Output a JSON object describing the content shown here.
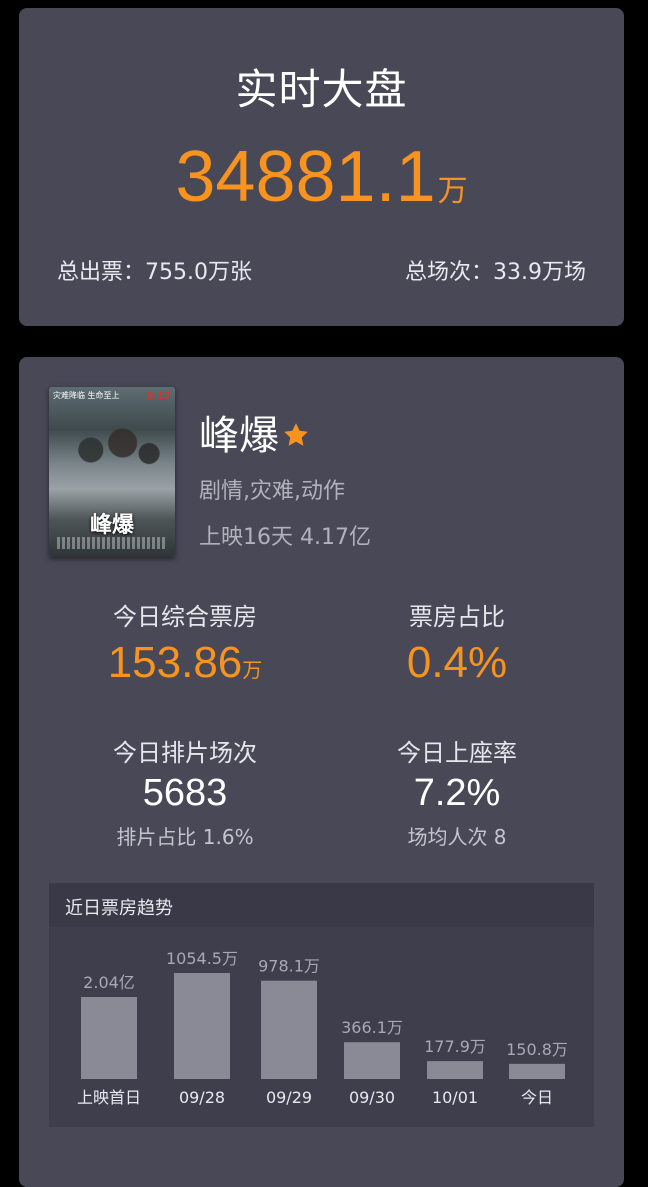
{
  "market": {
    "title": "实时大盘",
    "total_value": "34881.1",
    "total_unit": "万",
    "tickets": "总出票：755.0万张",
    "shows": "总场次：33.9万场"
  },
  "movie": {
    "title": "峰爆",
    "poster_title": "峰爆",
    "poster_tag": "9.17",
    "poster_side": "灾难降临 生命至上",
    "genre": "剧情,灾难,动作",
    "release": "上映16天  4.17亿"
  },
  "metrics": {
    "box_office": {
      "label": "今日综合票房",
      "value": "153.86",
      "unit": "万"
    },
    "share": {
      "label": "票房占比",
      "value": "0.4%"
    },
    "shows": {
      "label": "今日排片场次",
      "value": "5683",
      "sub": "排片占比 1.6%"
    },
    "occupancy": {
      "label": "今日上座率",
      "value": "7.2%",
      "sub": "场均人次 8"
    }
  },
  "colors": {
    "accent": "#f7931e",
    "card": "#494857",
    "bar": "#8a8a96"
  },
  "icons": {
    "favorite": "star-icon"
  },
  "chart_data": {
    "type": "bar",
    "title": "近日票房趋势",
    "categories": [
      "上映首日",
      "09/28",
      "09/29",
      "09/30",
      "10/01",
      "今日"
    ],
    "values": [
      20400,
      1054.5,
      978.1,
      366.1,
      177.9,
      150.8
    ],
    "value_labels": [
      "2.04亿",
      "1054.5万",
      "978.1万",
      "366.1万",
      "177.9万",
      "150.8万"
    ],
    "unit": "万"
  }
}
